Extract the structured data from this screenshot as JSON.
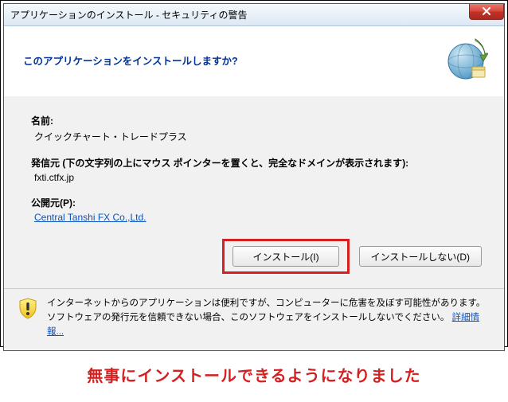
{
  "title": "アプリケーションのインストール - セキュリティの警告",
  "question": "このアプリケーションをインストールしますか?",
  "fields": {
    "name_label": "名前:",
    "name_value": "クイックチャート・トレードプラス",
    "origin_label": "発信元 (下の文字列の上にマウス ポインターを置くと、完全なドメインが表示されます):",
    "origin_value": "fxti.ctfx.jp",
    "publisher_label": "公開元(P):",
    "publisher_value": "Central Tanshi FX Co.,Ltd."
  },
  "buttons": {
    "install": "インストール(I)",
    "dont_install": "インストールしない(D)"
  },
  "footer": {
    "text": "インターネットからのアプリケーションは便利ですが、コンピューターに危害を及ぼす可能性があります。ソフトウェアの発行元を信頼できない場合、このソフトウェアをインストールしないでください。",
    "more_info": "詳細情報..."
  },
  "caption": "無事にインストールできるようになりました"
}
